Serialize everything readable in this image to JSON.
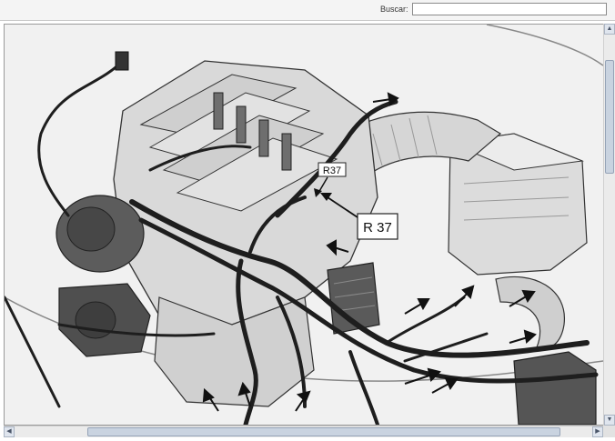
{
  "toolbar": {
    "search_label": "Buscar:",
    "search_placeholder": ""
  },
  "diagram": {
    "callout_small": "R37",
    "callout_large": "R 37"
  },
  "scrollbars": {
    "up": "▲",
    "down": "▼",
    "left": "◀",
    "right": "▶"
  },
  "colors": {
    "background": "#f1f1f1",
    "line": "#222222",
    "part_fill": "#d9d9d9",
    "dark_part": "#5a5a5a"
  }
}
